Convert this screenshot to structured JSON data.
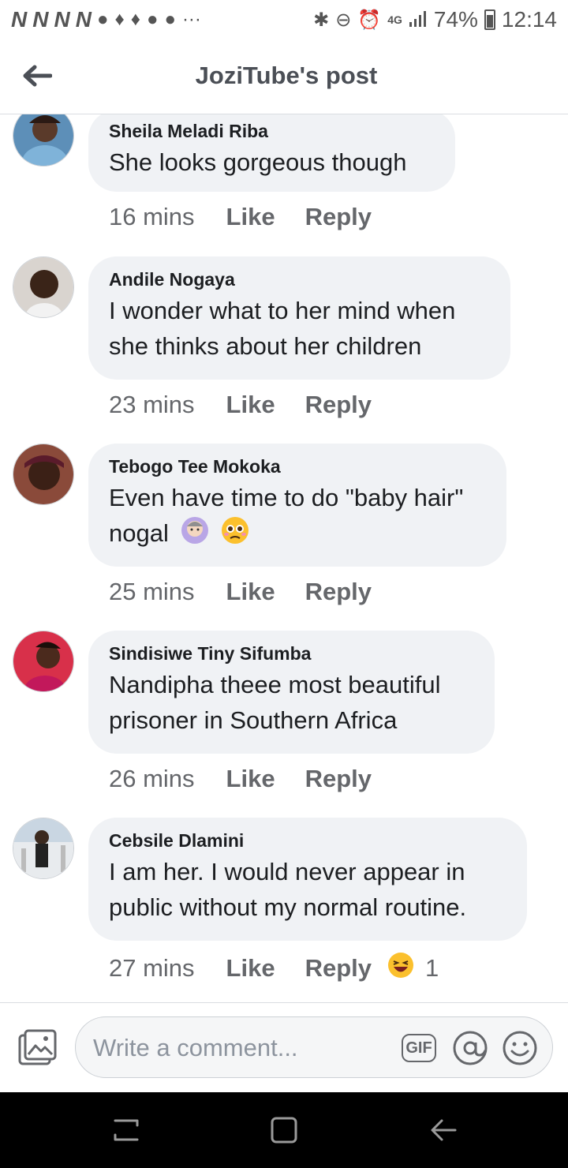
{
  "status_bar": {
    "left_icons": [
      "N",
      "N",
      "N",
      "N"
    ],
    "network": "4G",
    "battery": "74%",
    "time": "12:14"
  },
  "header": {
    "title": "JoziTube's post",
    "back_icon": "arrow-left-icon"
  },
  "comments": [
    {
      "name": "Sheila Meladi Riba",
      "text": "She looks gorgeous though",
      "time": "16 mins",
      "like": "Like",
      "reply": "Reply"
    },
    {
      "name": "Andile Nogaya",
      "text": "I wonder what to her mind when she thinks about her children",
      "time": "23 mins",
      "like": "Like",
      "reply": "Reply"
    },
    {
      "name": "Tebogo Tee Mokoka",
      "text": "Even have time to do \"baby hair\" nogal",
      "emojis": [
        "facepalm-woman-emoji",
        "pleading-face-emoji"
      ],
      "time": "25 mins",
      "like": "Like",
      "reply": "Reply"
    },
    {
      "name": "Sindisiwe Tiny Sifumba",
      "text": "Nandipha theee most beautiful prisoner in Southern Africa",
      "time": "26 mins",
      "like": "Like",
      "reply": "Reply"
    },
    {
      "name": "Cebsile Dlamini",
      "text": "I am her. I would never appear in public without my normal routine.",
      "time": "27 mins",
      "like": "Like",
      "reply": "Reply",
      "reaction": {
        "icon": "laughing-emoji",
        "count": "1"
      }
    }
  ],
  "composer": {
    "placeholder": "Write a comment...",
    "gif_label": "GIF",
    "photo_icon": "photo-icon",
    "mention_icon": "at-icon",
    "emoji_icon": "smiley-icon"
  },
  "nav_bar": {
    "icons": [
      "recents-icon",
      "home-icon",
      "back-icon"
    ]
  },
  "colors": {
    "bubble": "#f0f2f5",
    "secondary_text": "#65676b",
    "navbar": "#000000"
  }
}
